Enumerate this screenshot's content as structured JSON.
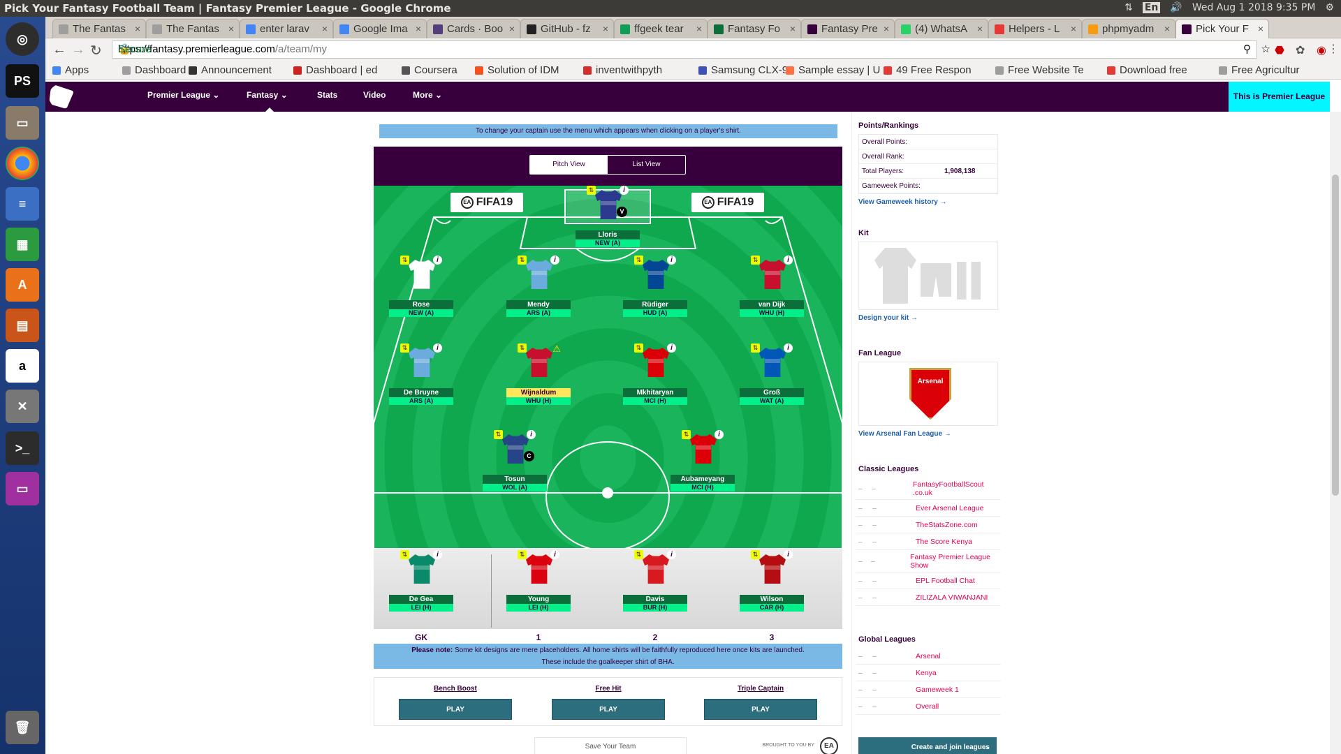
{
  "os": {
    "window_title": "Pick Your Fantasy Football Team | Fantasy Premier League - Google Chrome",
    "keyboard": "En",
    "datetime": "Wed Aug  1 2018  9:35 PM"
  },
  "browser": {
    "tabs": [
      {
        "label": "The Fantas",
        "color": "#9e9e9e"
      },
      {
        "label": "The Fantas",
        "color": "#9e9e9e"
      },
      {
        "label": "enter larav",
        "color": "#4285f4"
      },
      {
        "label": "Google Ima",
        "color": "#4285f4"
      },
      {
        "label": "Cards · Boo",
        "color": "#563d7c"
      },
      {
        "label": "GitHub - fz",
        "color": "#222222"
      },
      {
        "label": "ffgeek tear",
        "color": "#0f9d58"
      },
      {
        "label": "Fantasy Fo",
        "color": "#0b6e3b"
      },
      {
        "label": "Fantasy Pre",
        "color": "#37003c"
      },
      {
        "label": "(4) WhatsA",
        "color": "#25d366"
      },
      {
        "label": "Helpers - L",
        "color": "#e53935"
      },
      {
        "label": "phpmyadm",
        "color": "#f89c0e"
      },
      {
        "label": "Pick Your F",
        "color": "#37003c"
      }
    ],
    "secure_label": "Secure",
    "url_prefix": "https://fantasy.premierleague.com",
    "url_path": "/a/team/my",
    "bookmarks": [
      "Apps",
      "Dashboard",
      "Announcement",
      "Dashboard | ed",
      "Coursera",
      "Solution of IDM",
      "inventwithpyth",
      "Samsung CLX-9",
      "Sample essay | U",
      "49 Free Respon",
      "Free Website Te",
      "Download free",
      "Free Agricultur"
    ]
  },
  "site": {
    "nav": [
      "Premier League",
      "Fantasy",
      "Stats",
      "Video",
      "More"
    ],
    "cta": "This is Premier League",
    "captain_note": "To change your captain use the menu which appears when clicking on a player's shirt.",
    "views": {
      "pitch": "Pitch View",
      "list": "List View"
    },
    "adboard": "FIFA19",
    "adboard_ea": "EA",
    "goalkeeper": {
      "name": "Lloris",
      "fixture": "NEW (A)",
      "badge": "V",
      "shirt": "#2b3a8f"
    },
    "defenders": [
      {
        "name": "Rose",
        "fixture": "NEW (A)",
        "shirt": "#ffffff"
      },
      {
        "name": "Mendy",
        "fixture": "ARS (A)",
        "shirt": "#6cabdd"
      },
      {
        "name": "Rüdiger",
        "fixture": "HUD (A)",
        "shirt": "#034694"
      },
      {
        "name": "van Dijk",
        "fixture": "WHU (H)",
        "shirt": "#c8102e"
      }
    ],
    "midfielders": [
      {
        "name": "De Bruyne",
        "fixture": "ARS (A)",
        "shirt": "#6cabdd"
      },
      {
        "name": "Wijnaldum",
        "fixture": "WHU (H)",
        "shirt": "#c8102e",
        "flag": "⚠"
      },
      {
        "name": "Mkhitaryan",
        "fixture": "MCI (H)",
        "shirt": "#db0007"
      },
      {
        "name": "Groß",
        "fixture": "WAT (A)",
        "shirt": "#0057b8"
      }
    ],
    "forwards": [
      {
        "name": "Tosun",
        "fixture": "WOL (A)",
        "shirt": "#274488",
        "badge": "C"
      },
      {
        "name": "Aubameyang",
        "fixture": "MCI (H)",
        "shirt": "#db0007"
      }
    ],
    "bench": [
      {
        "name": "De Gea",
        "fixture": "LEI (H)",
        "shirt": "#0a8a6a",
        "pos": "GK"
      },
      {
        "name": "Young",
        "fixture": "LEI (H)",
        "shirt": "#da020e",
        "pos": "1"
      },
      {
        "name": "Davis",
        "fixture": "BUR (H)",
        "shirt": "#d71920",
        "pos": "2"
      },
      {
        "name": "Wilson",
        "fixture": "CAR (H)",
        "shirt": "#b50e12",
        "pos": "3"
      }
    ],
    "sub_icon": "⇅",
    "info_icon": "i",
    "kit_note_bold": "Please note:",
    "kit_note": "Some kit designs are mere placeholders. All home shirts will be faithfully reproduced here once kits are launched.",
    "kit_note2": "These include the goalkeeper shirt of BHA.",
    "chips": [
      {
        "label": "Bench Boost",
        "button": "PLAY"
      },
      {
        "label": "Free Hit",
        "button": "PLAY"
      },
      {
        "label": "Triple Captain",
        "button": "PLAY"
      }
    ],
    "save_label": "Save Your Team",
    "brought_by": "BROUGHT TO YOU BY",
    "sidebar": {
      "points_title": "Points/Rankings",
      "rows": [
        {
          "k": "Overall Points:",
          "v": ""
        },
        {
          "k": "Overall Rank:",
          "v": ""
        },
        {
          "k": "Total Players:",
          "v": "1,908,138"
        },
        {
          "k": "Gameweek Points:",
          "v": ""
        }
      ],
      "gw_history": "View Gameweek history →",
      "kit_title": "Kit",
      "design_kit": "Design your kit →",
      "fan_title": "Fan League",
      "fan_club": "Arsenal",
      "view_fan": "View Arsenal Fan League →",
      "classic_title": "Classic Leagues",
      "classic": [
        "FantasyFootballScout .co.uk",
        "Ever Arsenal League",
        "TheStatsZone.com",
        "The Score Kenya",
        "Fantasy Premier League Show",
        "EPL Football Chat",
        "ZILIZALA VIWANJANI"
      ],
      "global_title": "Global Leagues",
      "global": [
        "Arsenal",
        "Kenya",
        "Gameweek 1",
        "Overall"
      ],
      "dash": "–",
      "create": "Create and join leagues",
      "create_arrow": "→"
    }
  }
}
